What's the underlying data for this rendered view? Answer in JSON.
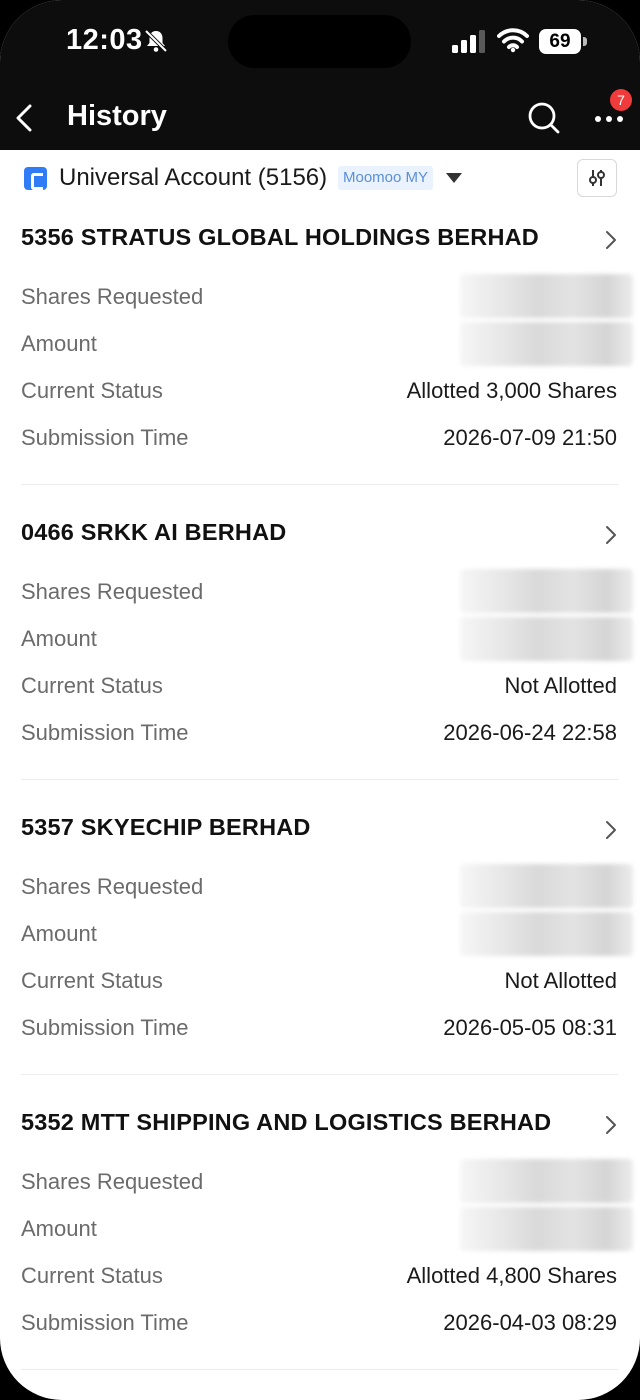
{
  "status_bar": {
    "time": "12:03",
    "battery": "69"
  },
  "nav": {
    "title": "History",
    "badge_count": "7"
  },
  "account": {
    "name": "Universal Account (5156)",
    "tag": "Moomoo MY"
  },
  "labels": {
    "shares_requested": "Shares Requested",
    "amount": "Amount",
    "current_status": "Current Status",
    "submission_time": "Submission Time"
  },
  "applications": [
    {
      "title": "5356 STRATUS GLOBAL HOLDINGS BERHAD",
      "status": "Allotted 3,000 Shares",
      "time": "2026-07-09 21:50"
    },
    {
      "title": "0466 SRKK AI BERHAD",
      "status": "Not Allotted",
      "time": "2026-06-24 22:58"
    },
    {
      "title": "5357 SKYECHIP BERHAD",
      "status": "Not Allotted",
      "time": "2026-05-05 08:31"
    },
    {
      "title": "5352 MTT SHIPPING AND LOGISTICS BERHAD",
      "status": "Allotted 4,800 Shares",
      "time": "2026-04-03 08:29"
    }
  ],
  "colors": {
    "nav_bg": "#0d0d0d",
    "badge": "#ef3b3b",
    "account_logo": "#2f7cf6",
    "tag_bg": "#eaf2fd",
    "tag_text": "#5b8fd6"
  }
}
